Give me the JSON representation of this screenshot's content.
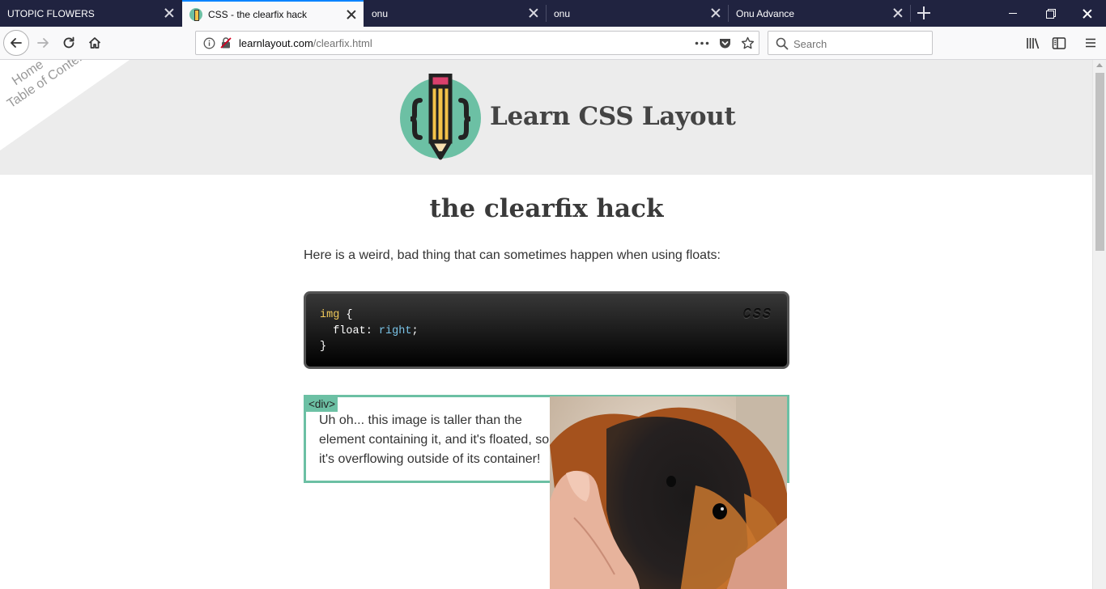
{
  "browser": {
    "tabs": [
      {
        "title": "UTOPIC FLOWERS",
        "active": false
      },
      {
        "title": "CSS - the clearfix hack",
        "active": true
      },
      {
        "title": "onu",
        "active": false
      },
      {
        "title": "onu",
        "active": false
      },
      {
        "title": "Onu Advance",
        "active": false
      }
    ],
    "url_domain": "learnlayout.com",
    "url_path": "/clearfix.html",
    "search_placeholder": "Search"
  },
  "page": {
    "nav_links": [
      "Home",
      "Table of Contents"
    ],
    "site_title": "Learn CSS Layout",
    "heading": "the clearfix hack",
    "intro": "Here is a weird, bad thing that can sometimes happen when using floats:",
    "code": {
      "language": "CSS",
      "line1_selector": "img",
      "line1_brace": " {",
      "line2_property": "  float: ",
      "line2_value": "right",
      "line2_end": ";",
      "line3": "}"
    },
    "demo": {
      "tag": "<div>",
      "text": "Uh oh... this image is taller than the element containing it, and it's floated, so it's overflowing outside of its container!"
    }
  },
  "colors": {
    "accent": "#6cc0a4",
    "tabstrip": "#202340",
    "active_tab_line": "#0a84ff"
  }
}
